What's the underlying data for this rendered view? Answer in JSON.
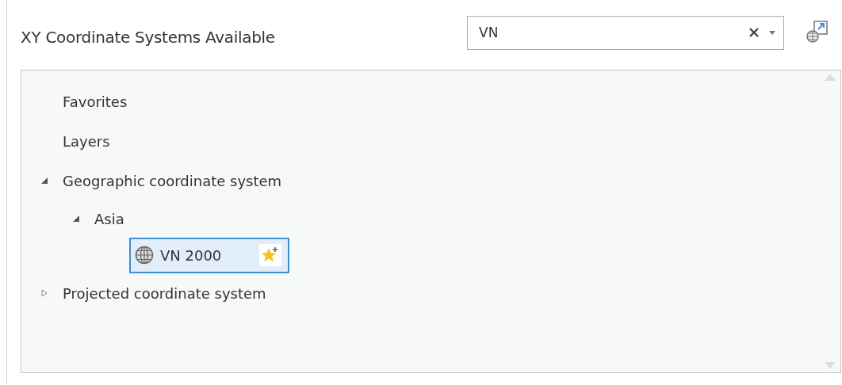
{
  "title": "XY Coordinate Systems Available",
  "search": {
    "value": "VN"
  },
  "tree": [
    {
      "label": "Favorites",
      "kind": "group",
      "selected": false
    },
    {
      "label": "Layers",
      "kind": "group",
      "selected": false
    },
    {
      "label": "Geographic coordinate system",
      "kind": "category",
      "expanded": true,
      "selected": false,
      "children": [
        {
          "label": "Asia",
          "kind": "category",
          "expanded": true,
          "selected": false,
          "children": [
            {
              "label": "VN 2000",
              "kind": "system",
              "selected": true
            }
          ]
        }
      ]
    },
    {
      "label": "Projected coordinate system",
      "kind": "category",
      "expanded": false,
      "selected": false
    }
  ]
}
